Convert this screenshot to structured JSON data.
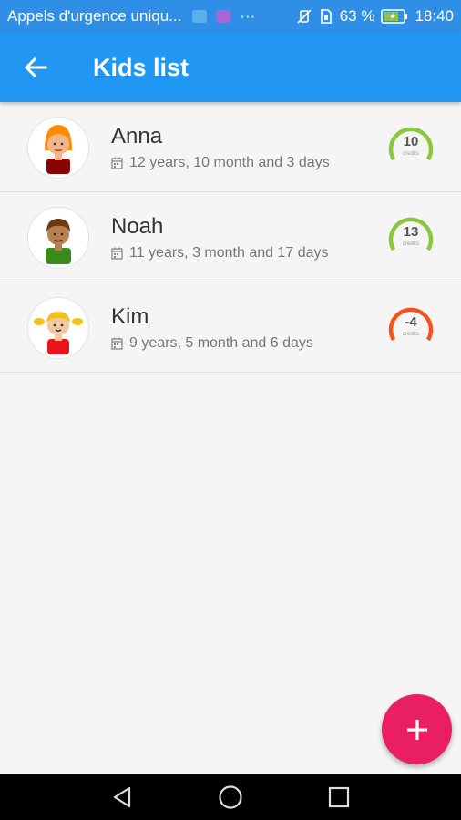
{
  "status_bar": {
    "notification_text": "Appels d'urgence uniqu...",
    "overflow_dots": "···",
    "battery_percent": "63 %",
    "time": "18:40"
  },
  "app_bar": {
    "title": "Kids list"
  },
  "kids": [
    {
      "name": "Anna",
      "age": "12 years, 10 month and 3 days",
      "credits": "10",
      "credits_label": "credits",
      "ring_color": "#8cc63f",
      "avatar": "girl-orange-hair-icon"
    },
    {
      "name": "Noah",
      "age": "11 years, 3 month and 17 days",
      "credits": "13",
      "credits_label": "credits",
      "ring_color": "#8cc63f",
      "avatar": "boy-brown-hair-icon"
    },
    {
      "name": "Kim",
      "age": "9 years, 5 month and 6 days",
      "credits": "-4",
      "credits_label": "credits",
      "ring_color": "#f4511e",
      "avatar": "girl-pigtails-icon"
    }
  ],
  "colors": {
    "app_bar": "#2196f3",
    "fab": "#e91e63"
  },
  "fab": {
    "icon": "plus-icon"
  },
  "nav": {
    "back": "back-triangle-icon",
    "home": "home-circle-icon",
    "recents": "recents-square-icon"
  }
}
